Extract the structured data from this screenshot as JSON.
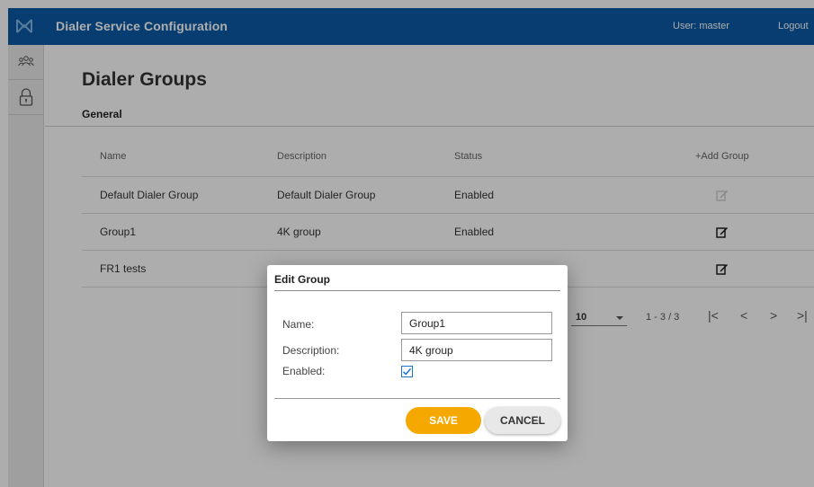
{
  "app": {
    "title": "Dialer Service Configuration",
    "user_label": "User:  master",
    "logout_label": "Logout"
  },
  "sidebar": {
    "items": [
      {
        "icon": "users-group-icon"
      },
      {
        "icon": "lock-icon"
      }
    ]
  },
  "page": {
    "title": "Dialer Groups",
    "section": "General"
  },
  "table": {
    "headers": {
      "name": "Name",
      "description": "Description",
      "status": "Status",
      "add": "+Add Group"
    },
    "rows": [
      {
        "name": "Default Dialer Group",
        "description": "Default Dialer Group",
        "status": "Enabled",
        "editable": false
      },
      {
        "name": "Group1",
        "description": "4K group",
        "status": "Enabled",
        "editable": true
      },
      {
        "name": "FR1 tests",
        "description": "",
        "status": "",
        "editable": true
      }
    ]
  },
  "pager": {
    "page_size": "10",
    "range": "1 - 3 / 3",
    "first": "|<",
    "prev": "<",
    "next": ">",
    "last": ">|"
  },
  "dialog": {
    "title": "Edit Group",
    "name_label": "Name:",
    "name_value": "Group1",
    "description_label": "Description:",
    "description_value": "4K group",
    "enabled_label": "Enabled:",
    "enabled": true,
    "save_label": "SAVE",
    "cancel_label": "CANCEL"
  },
  "colors": {
    "topbar": "#0b5ba5",
    "save": "#f5a800",
    "checkbox": "#1976d2"
  }
}
